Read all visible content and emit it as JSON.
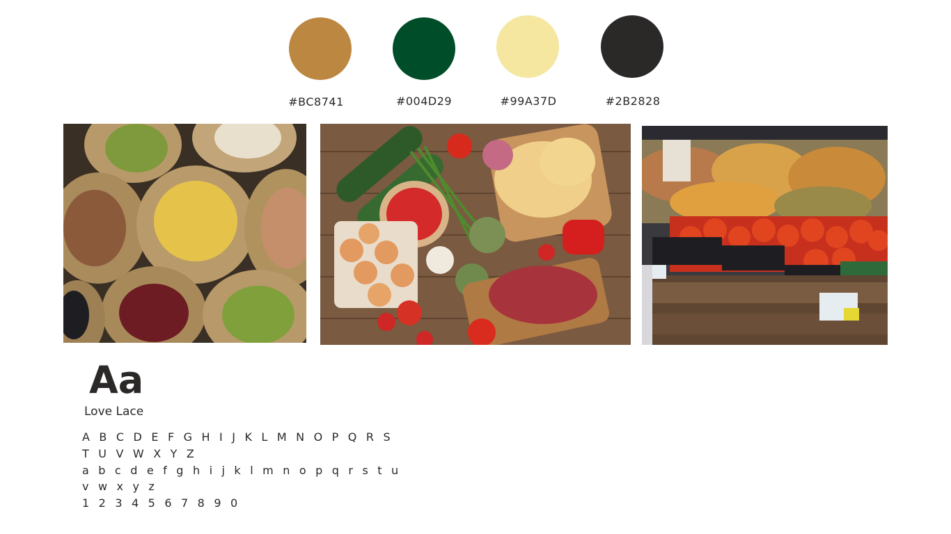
{
  "palette": [
    {
      "hex_label": "#BC8741",
      "color": "#BC8741"
    },
    {
      "hex_label": "#004D29",
      "color": "#004D29"
    },
    {
      "hex_label": "#99A37D",
      "color": "#F5E6A0"
    },
    {
      "hex_label": "#2B2828",
      "color": "#2B2828"
    }
  ],
  "typography": {
    "sample": "Aa",
    "font_name": "Love Lace",
    "charset": [
      "ABCDEFGHIJKLMNOPQRS",
      "TUVWXYZ",
      "abcdefghijklmnopqrstu",
      "vwxyz",
      "1234567890"
    ]
  },
  "charset_display": [
    "A B C D E F G H I J K L M N O P Q R S",
    "T U V W X Y Z",
    "a b c d e f g h i j k l m n o p q r s t u",
    "v w x y z",
    "1 2 3 4 5 6 7 8 9 0"
  ]
}
